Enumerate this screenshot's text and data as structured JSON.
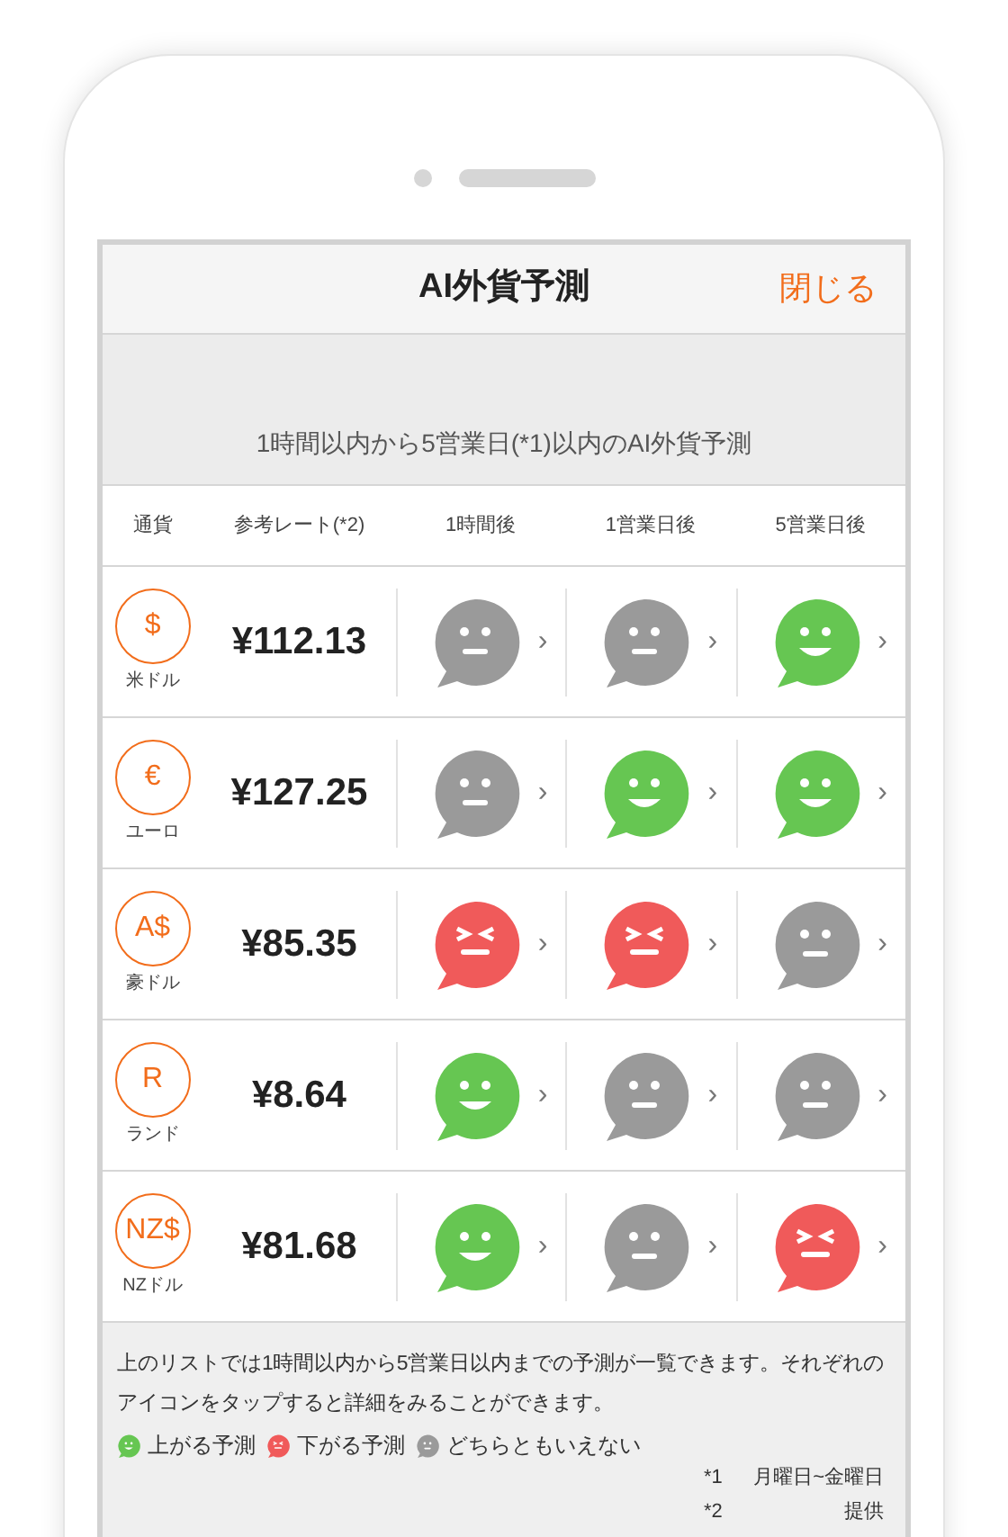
{
  "header": {
    "title": "AI外貨予測",
    "close": "閉じる"
  },
  "subtitle": "1時間以内から5営業日(*1)以内のAI外貨予測",
  "columns": [
    "通貨",
    "参考レート(*2)",
    "1時間後",
    "1営業日後",
    "5営業日後"
  ],
  "rows": [
    {
      "symbol": "$",
      "currency": "米ドル",
      "rate": "¥112.13",
      "forecasts": [
        {
          "kind": "neutral"
        },
        {
          "kind": "neutral"
        },
        {
          "kind": "up"
        }
      ]
    },
    {
      "symbol": "€",
      "currency": "ユーロ",
      "rate": "¥127.25",
      "forecasts": [
        {
          "kind": "neutral"
        },
        {
          "kind": "up"
        },
        {
          "kind": "up"
        }
      ]
    },
    {
      "symbol": "A$",
      "currency": "豪ドル",
      "rate": "¥85.35",
      "forecasts": [
        {
          "kind": "down"
        },
        {
          "kind": "down"
        },
        {
          "kind": "neutral"
        }
      ]
    },
    {
      "symbol": "R",
      "currency": "ランド",
      "rate": "¥8.64",
      "forecasts": [
        {
          "kind": "up"
        },
        {
          "kind": "neutral"
        },
        {
          "kind": "neutral"
        }
      ]
    },
    {
      "symbol": "NZ$",
      "currency": "NZドル",
      "rate": "¥81.68",
      "forecasts": [
        {
          "kind": "up"
        },
        {
          "kind": "neutral"
        },
        {
          "kind": "down"
        }
      ]
    }
  ],
  "chevron": "›",
  "note": "上のリストでは1時間以内から5営業日以内までの予測が一覧できます。それぞれのアイコンをタップすると詳細をみることができます。",
  "legend": [
    {
      "kind": "up",
      "label": "上がる予測"
    },
    {
      "kind": "down",
      "label": "下がる予測"
    },
    {
      "kind": "neutral",
      "label": "どちらともいえない"
    }
  ],
  "footnotes": [
    {
      "mark": "*1",
      "text": "月曜日~金曜日"
    },
    {
      "mark": "*2",
      "text": "提供"
    }
  ]
}
